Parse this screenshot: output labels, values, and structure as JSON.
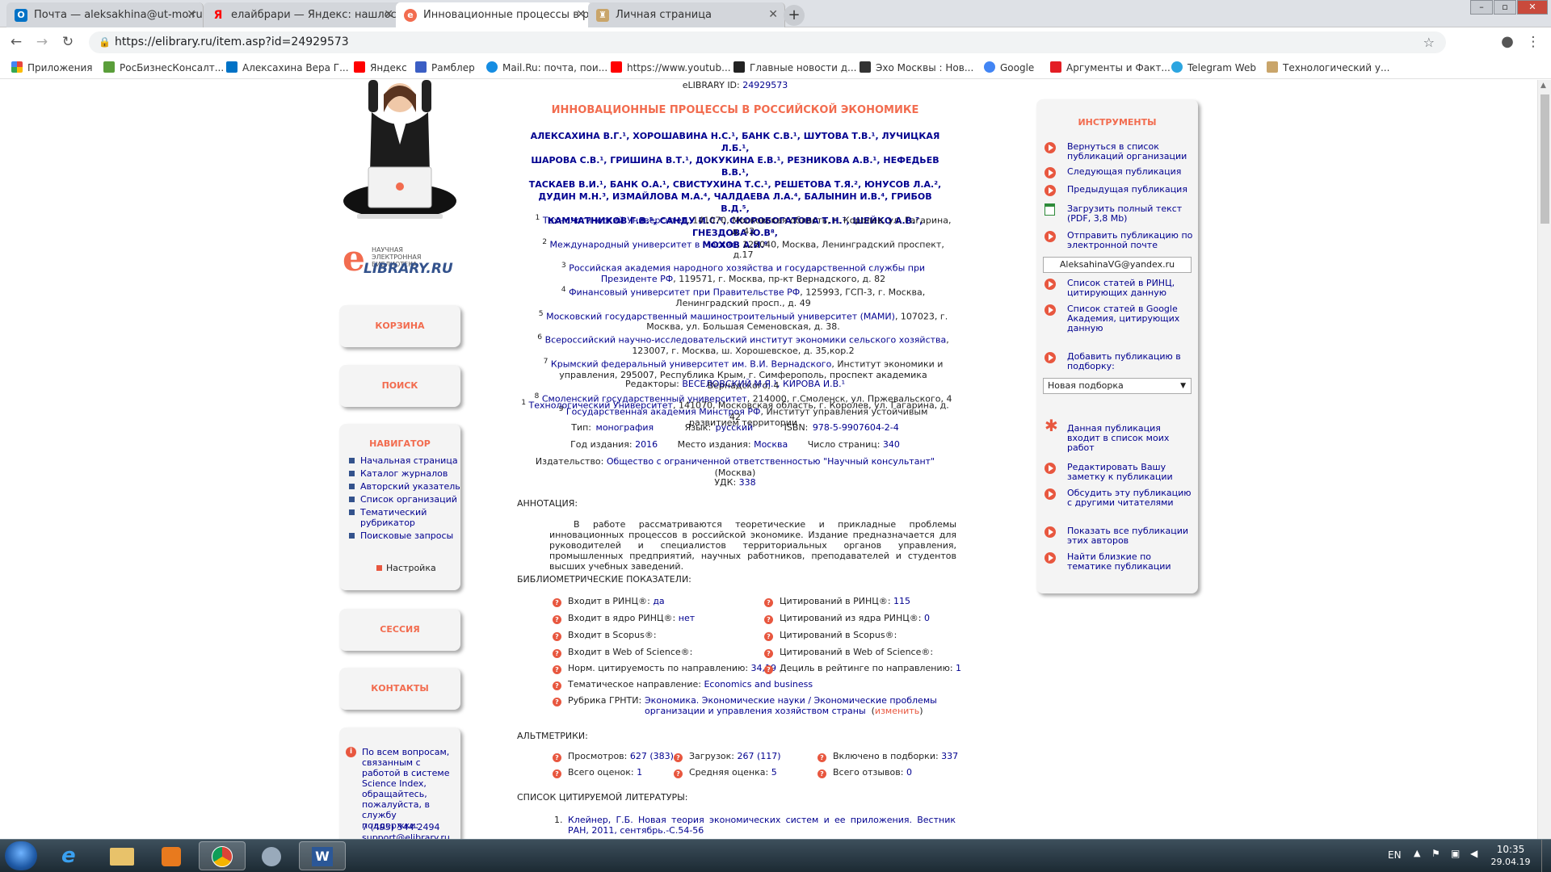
{
  "browser": {
    "tabs": [
      {
        "title": "Почта — aleksakhina@ut-mo.ru",
        "icon": "outlook-icon",
        "color": "#0072c6"
      },
      {
        "title": "елайбрари — Яндекс: нашлось",
        "icon": "yandex-icon",
        "color": "#ff0000"
      },
      {
        "title": "Инновационные процессы в рс",
        "icon": "elibrary-icon",
        "color": "#f26c4f"
      },
      {
        "title": "Личная страница",
        "icon": "elibrary-icon",
        "color": "#c9a56a"
      }
    ],
    "url": "https://elibrary.ru/item.asp?id=24929573",
    "bookmarks": [
      {
        "label": "Приложения",
        "color": "#e8453c"
      },
      {
        "label": "РосБизнесКонсалт...",
        "color": "#5a9e3a"
      },
      {
        "label": "Алексахина Вера Г...",
        "color": "#0072c6"
      },
      {
        "label": "Яндекс",
        "color": "#ff0000"
      },
      {
        "label": "Рамблер",
        "color": "#3b5ec4"
      },
      {
        "label": "Mail.Ru: почта, пои...",
        "color": "#168de2"
      },
      {
        "label": "https://www.youtub...",
        "color": "#ff0000"
      },
      {
        "label": "Главные новости д...",
        "color": "#222222"
      },
      {
        "label": "Эхо Москвы : Нов...",
        "color": "#333333"
      },
      {
        "label": "Google",
        "color": "#4285f4"
      },
      {
        "label": "Аргументы и Факт...",
        "color": "#e31e24"
      },
      {
        "label": "Telegram Web",
        "color": "#2ca5e0"
      },
      {
        "label": "Технологический у...",
        "color": "#c9a56a"
      }
    ]
  },
  "left": {
    "logo_small": "НАУЧНАЯ ЭЛЕКТРОННАЯ БИБЛИОТЕКА",
    "logo_big": "LIBRARY.RU",
    "logo_e": "e",
    "cart": "КОРЗИНА",
    "search": "ПОИСК",
    "navigator_title": "НАВИГАТОР",
    "nav_items": [
      "Начальная страница",
      "Каталог журналов",
      "Авторский указатель",
      "Список организаций",
      "Тематический рубрикатор",
      "Поисковые запросы"
    ],
    "settings": "Настройка",
    "session": "СЕССИЯ",
    "contacts": "КОНТАКТЫ",
    "support_text": "По всем вопросам, связанным с работой в системе Science Index, обращайтесь, пожалуйста, в службу поддержки:",
    "support_phone": "7 (495) 544-2494",
    "support_email": "support@elibrary.ru"
  },
  "article": {
    "id_label": "eLIBRARY ID:",
    "id_value": "24929573",
    "title": "ИННОВАЦИОННЫЕ ПРОЦЕССЫ В РОССИЙСКОЙ ЭКОНОМИКЕ",
    "authors": [
      "АЛЕКСАХИНА В.Г.¹, ХОРОШАВИНА Н.С.¹, БАНК С.В.¹, ШУТОВА Т.В.¹, ЛУЧИЦКАЯ Л.Б.¹,",
      "ШАРОВА С.В.¹, ГРИШИНА В.Т.¹, ДОКУКИНА Е.В.¹, РЕЗНИКОВА А.В.¹, НЕФЕДЬЕВ В.В.¹,",
      "ТАСКАЕВ В.И.¹, БАНК О.А.¹, СВИСТУХИНА Т.С.¹, РЕШЕТОВА Т.Я.², ЮНУСОВ Л.А.²,",
      "ДУДИН М.Н.³, ИЗМАЙЛОВА М.А.⁴, ЧАЛДАЕВА Л.А.⁴, БАЛЫНИН И.В.⁴, ГРИБОВ В.Д.⁵,",
      "КАМЧАТНИКОВ Г.В.⁵, САНДУ И.С.⁶, СКОРОБОГАТОВА Т.Н.⁷, ШЕЙКО А.В.⁷, ГНЕЗДОВА Ю.В⁸,",
      "МОХОВ А.И.⁹"
    ],
    "affiliations": [
      {
        "n": "1",
        "org": "Технологический Университет",
        "addr": ", 141070, Московская область, г. Королев, ул. Гагарина, д. 42"
      },
      {
        "n": "2",
        "org": "Международный университет в Москве",
        "addr": ", 125040, Москва, Ленинградский проспект, д.17"
      },
      {
        "n": "3",
        "org": "Российская академия народного хозяйства и государственной службы при Президенте РФ",
        "addr": ", 119571, г. Москва, пр-кт Вернадского, д. 82"
      },
      {
        "n": "4",
        "org": "Финансовый университет при Правительстве РФ",
        "addr": ", 125993, ГСП-3, г. Москва, Ленинградский просп., д. 49"
      },
      {
        "n": "5",
        "org": "Московский государственный машиностроительный университет (МАМИ)",
        "addr": ", 107023, г. Москва, ул. Большая Семеновская, д. 38."
      },
      {
        "n": "6",
        "org": "Всероссийский научно-исследовательский институт экономики сельского хозяйства",
        "addr": ", 123007, г. Москва, ш. Хорошевское, д. 35,кор.2"
      },
      {
        "n": "7",
        "org": "Крымский федеральный университет им. В.И. Вернадского",
        "addr": ", Институт экономики и управления, 295007, Республика Крым, г. Симферополь, проспект академика Вернадского, 4"
      },
      {
        "n": "8",
        "org": "Смоленский государственный университет",
        "addr": ", 214000, г.Смоленск, ул. Пржевальского, 4"
      },
      {
        "n": "9",
        "org": "Государственная академия Минстроя РФ",
        "addr": ", Институт управления устойчивым развитием территории"
      }
    ],
    "editors_label": "Редакторы:",
    "editors": "ВЕСЕЛОВСКИЙ М.Я.¹, КИРОВА И.В.¹",
    "editors_aff_n": "1",
    "editors_aff_org": "Технологический Университет",
    "editors_aff_addr": ", 141070, Московская область, г. Королев, ул. Гагарина, д. 42",
    "type_label": "Тип:",
    "type_value": "монография",
    "lang_label": "Язык:",
    "lang_value": "русский",
    "isbn_label": "ISBN:",
    "isbn_value": "978-5-9907604-2-4",
    "year_label": "Год издания:",
    "year_value": "2016",
    "place_label": "Место издания:",
    "place_value": "Москва",
    "pages_label": "Число страниц:",
    "pages_value": "340",
    "publisher_label": "Издательство:",
    "publisher_value": "Общество с ограниченной ответственностью \"Научный консультант\"",
    "publisher_city": "(Москва)",
    "udk_label": "УДК:",
    "udk_value": "338",
    "annotation_title": "АННОТАЦИЯ:",
    "annotation": "В работе рассматриваются теоретические и прикладные проблемы инновационных процессов в российской экономике. Издание предназначается для руководителей и специалистов территориальных органов управления, промышленных предприятий, научных работников, преподавателей и студентов высших учебных заведений."
  },
  "metrics": {
    "title": "БИБЛИОМЕТРИЧЕСКИЕ ПОКАЗАТЕЛИ:",
    "left": [
      {
        "label": "Входит в РИНЦ®:",
        "value": "да"
      },
      {
        "label": "Входит в ядро РИНЦ®:",
        "value": "нет"
      },
      {
        "label": "Входит в Scopus®:",
        "value": ""
      },
      {
        "label": "Входит в Web of Science®:",
        "value": ""
      },
      {
        "label": "Норм. цитируемость по направлению:",
        "value": "34,19"
      }
    ],
    "right": [
      {
        "label": "Цитирований в РИНЦ®:",
        "value": "115"
      },
      {
        "label": "Цитирований из ядра РИНЦ®:",
        "value": "0"
      },
      {
        "label": "Цитирований в Scopus®:",
        "value": ""
      },
      {
        "label": "Цитирований в Web of Science®:",
        "value": ""
      },
      {
        "label": "Дециль в рейтинге по направлению:",
        "value": "1"
      }
    ],
    "direction_label": "Тематическое направление:",
    "direction_value": "Economics and business",
    "grnti_label": "Рубрика ГРНТИ:",
    "grnti_value": "Экономика. Экономические науки / Экономические проблемы организации и управления хозяйством страны",
    "grnti_change": "изменить"
  },
  "altmetrics": {
    "title": "АЛЬТМЕТРИКИ:",
    "views_label": "Просмотров:",
    "views_value": "627 (383)",
    "downloads_label": "Загрузок:",
    "downloads_value": "267 (117)",
    "collections_label": "Включено в подборки:",
    "collections_value": "337",
    "ratings_label": "Всего оценок:",
    "ratings_value": "1",
    "avg_label": "Средняя оценка:",
    "avg_value": "5",
    "reviews_label": "Всего отзывов:",
    "reviews_value": "0"
  },
  "refs": {
    "title": "СПИСОК ЦИТИРУЕМОЙ ЛИТЕРАТУРЫ:",
    "first_n": "1.",
    "first": "Клейнер, Г.Б. Новая теория экономических систем и ее приложения. Вестник РАН, 2011, сентябрь.-С.54-56"
  },
  "tools": {
    "title": "ИНСТРУМЕНТЫ",
    "items": [
      "Вернуться в список публикаций организации",
      "Следующая публикация",
      "Предыдущая публикация",
      "Загрузить полный текст (PDF, 3,8 Mb)",
      "Отправить публикацию по электронной почте",
      "Список статей в РИНЦ, цитирующих данную",
      "Список статей в Google Академия, цитирующих данную",
      "Добавить публикацию в подборку:",
      "Данная публикация входит в список моих работ",
      "Редактировать Вашу заметку к публикации",
      "Обсудить эту публикацию с другими читателями",
      "Показать все публикации этих авторов",
      "Найти близкие по тематике публикации"
    ],
    "email_value": "AleksahinaVG@yandex.ru",
    "collection_select": "Новая подборка"
  },
  "taskbar": {
    "lang": "EN",
    "time": "10:35",
    "date": "29.04.19"
  }
}
